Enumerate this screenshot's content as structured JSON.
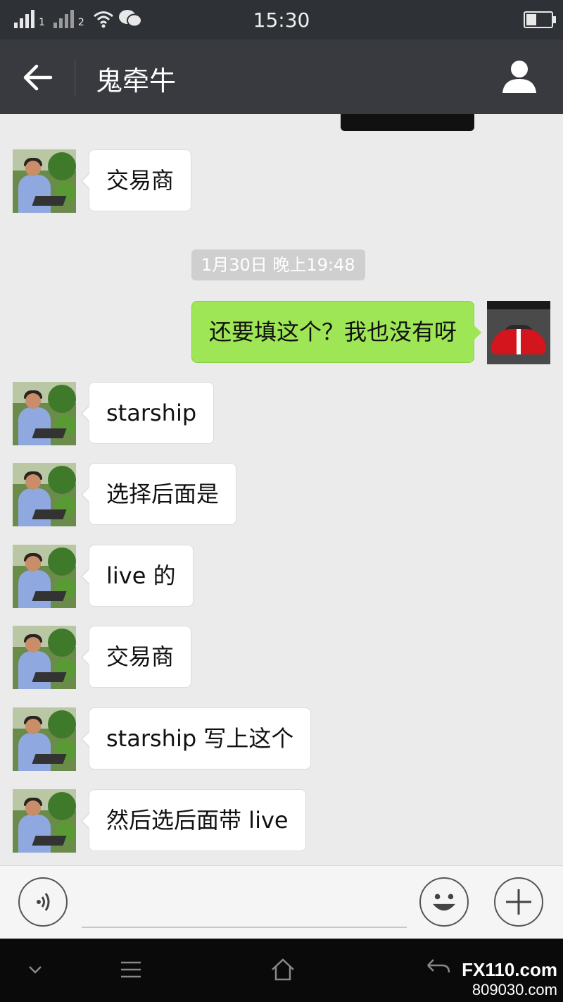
{
  "status_bar": {
    "sim1": "1",
    "sim2": "2",
    "time": "15:30"
  },
  "header": {
    "title": "鬼牵牛"
  },
  "messages": [
    {
      "side": "left",
      "text": "交易商"
    },
    {
      "side": "timestamp",
      "text": "1月30日 晚上19:48"
    },
    {
      "side": "right",
      "text": "还要填这个？我也没有呀"
    },
    {
      "side": "left",
      "text": "starship"
    },
    {
      "side": "left",
      "text": "选择后面是"
    },
    {
      "side": "left",
      "text": "live 的"
    },
    {
      "side": "left",
      "text": "交易商"
    },
    {
      "side": "left",
      "text": "starship 写上这个"
    },
    {
      "side": "left",
      "text": "然后选后面带 live"
    }
  ],
  "input_bar": {
    "voice_icon": "voice-icon",
    "emoji_icon": "emoji-icon",
    "plus_icon": "plus-icon"
  },
  "watermark": {
    "brand": "FX110.com",
    "number": "809030.com"
  },
  "colors": {
    "header_bg": "#393a3f",
    "sent_bubble": "#9fe657",
    "received_bubble": "#ffffff",
    "chat_bg": "#ebebeb"
  }
}
